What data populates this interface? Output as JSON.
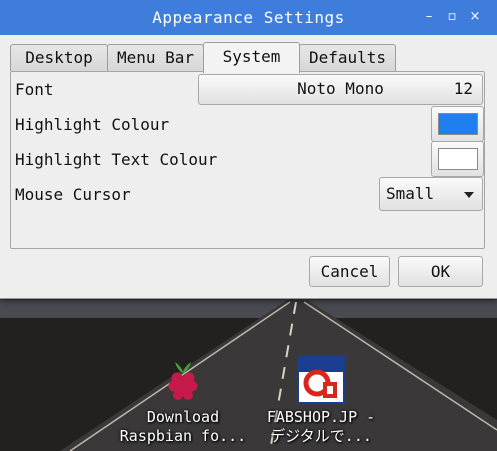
{
  "window": {
    "title": "Appearance Settings",
    "controls": {
      "minimize": "–",
      "maximize": "▫",
      "close": "×"
    }
  },
  "tabs": [
    {
      "label": "Desktop",
      "active": false
    },
    {
      "label": "Menu Bar",
      "active": false
    },
    {
      "label": "System",
      "active": true
    },
    {
      "label": "Defaults",
      "active": false
    }
  ],
  "system": {
    "font_label": "Font",
    "font_name": "Noto Mono",
    "font_size": "12",
    "highlight_colour_label": "Highlight Colour",
    "highlight_colour": "#1f7ef0",
    "highlight_text_colour_label": "Highlight Text Colour",
    "highlight_text_colour": "#ffffff",
    "mouse_cursor_label": "Mouse Cursor",
    "mouse_cursor_value": "Small"
  },
  "buttons": {
    "cancel": "Cancel",
    "ok": "OK"
  },
  "desktop_icons": [
    {
      "line1": "Download",
      "line2": "Raspbian fo...",
      "icon": "raspberry-icon"
    },
    {
      "line1": "FABSHOP.JP -",
      "line2": "デジタルで...",
      "icon": "fabshop-icon"
    }
  ]
}
